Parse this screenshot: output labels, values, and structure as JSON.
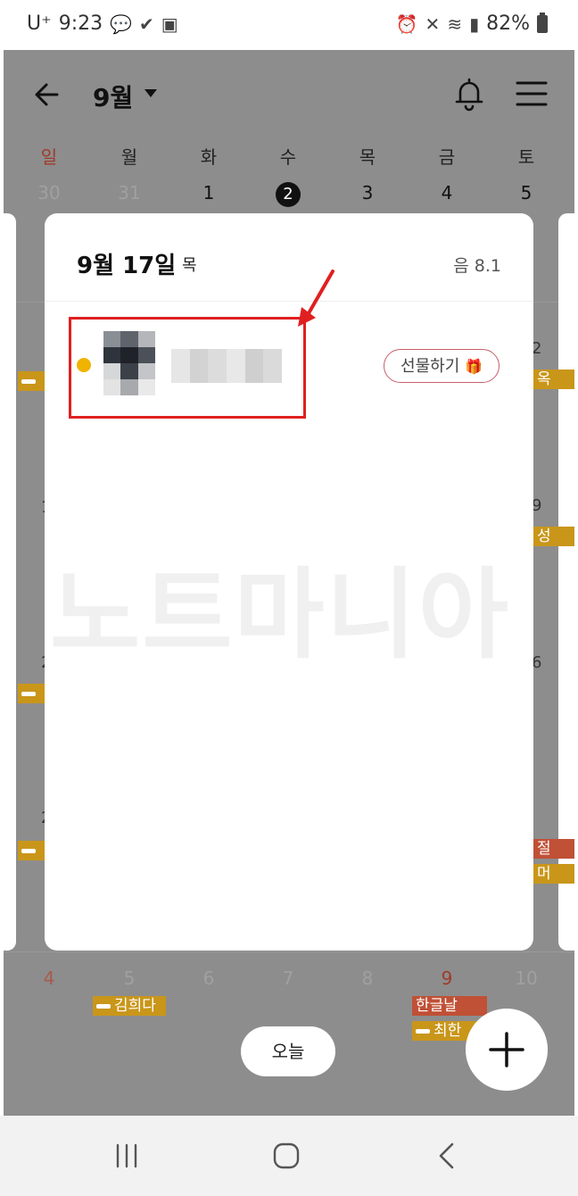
{
  "status_bar": {
    "carrier": "U⁺",
    "time": "9:23",
    "battery": "82%"
  },
  "header": {
    "month": "9월"
  },
  "weekdays": [
    "일",
    "월",
    "화",
    "수",
    "목",
    "금",
    "토"
  ],
  "week_dates": [
    "30",
    "31",
    "1",
    "2",
    "3",
    "4",
    "5"
  ],
  "today_date": "2",
  "edge_labels": {
    "right_1": "2",
    "right_2": "9",
    "right_3": "6",
    "left_1": "1",
    "left_2": "2",
    "left_3": "2"
  },
  "side_events": {
    "right_1": "옥",
    "right_2": "성",
    "right_3a": "절",
    "right_3b": "머"
  },
  "bottom_dates": [
    "4",
    "5",
    "6",
    "7",
    "8",
    "9",
    "10"
  ],
  "bottom_events": {
    "ev1": "김희다",
    "ev2": "한글날",
    "ev3": "최한"
  },
  "modal": {
    "date": "9월 17일",
    "day_of_week": "목",
    "lunar": "음 8.1",
    "gift_label": "선물하기",
    "watermark": "노트마니아"
  },
  "today_button": "오늘",
  "colors": {
    "accent_yellow": "#f0b300",
    "highlight_red": "#e02020",
    "event_gold": "#c9961a",
    "event_red": "#c05036"
  }
}
